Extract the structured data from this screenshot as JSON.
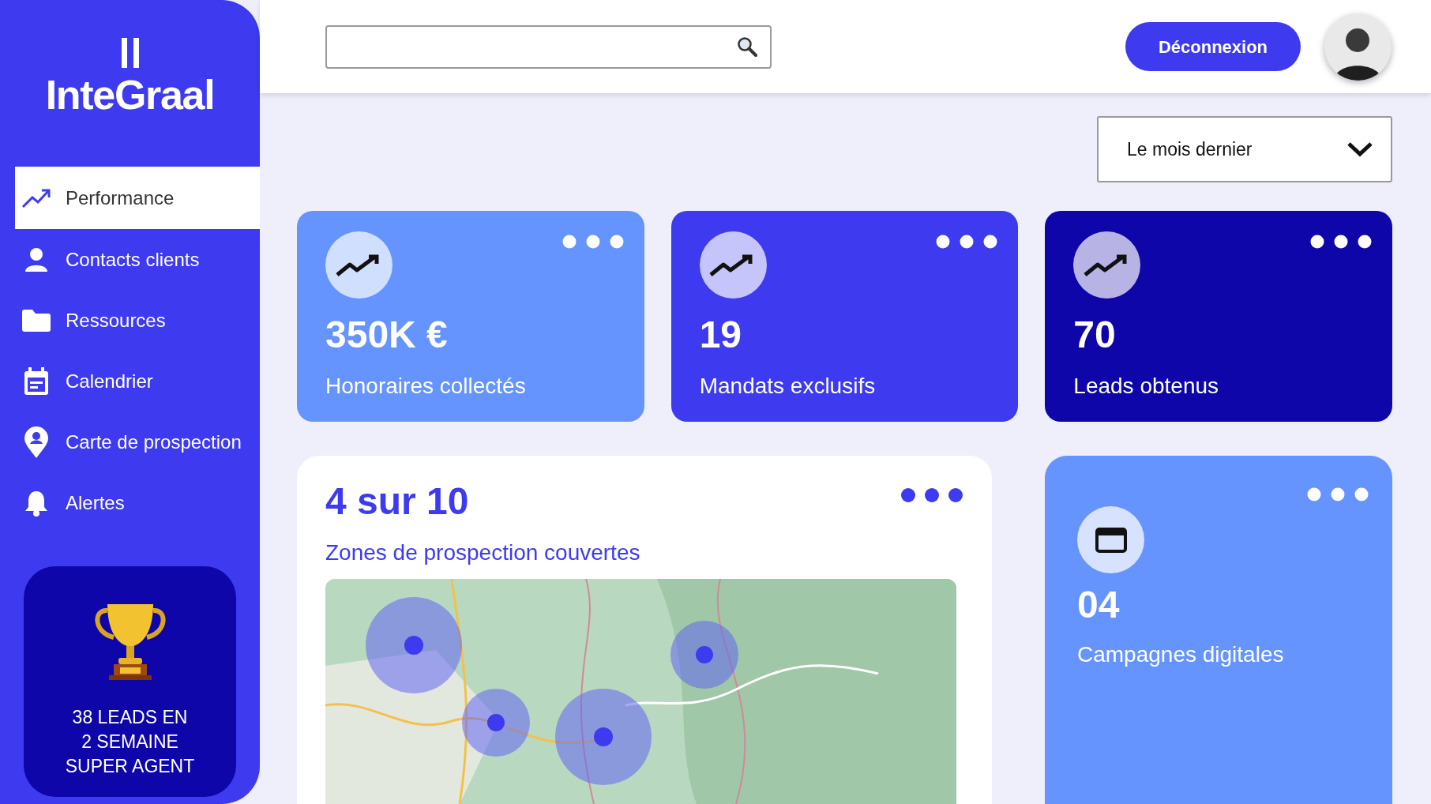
{
  "sidebar": {
    "logo": "InteGraal",
    "items": [
      {
        "kind": "trend",
        "label": "Performance",
        "selected": true
      },
      {
        "kind": "person",
        "label": "Contacts clients",
        "selected": false
      },
      {
        "kind": "folder",
        "label": "Ressources",
        "selected": false
      },
      {
        "kind": "calendar",
        "label": "Calendrier",
        "selected": false
      },
      {
        "kind": "pin",
        "label": "Carte de prospection",
        "selected": false
      },
      {
        "kind": "bell",
        "label": "Alertes",
        "selected": false
      }
    ],
    "award": {
      "lines": [
        "38 LEADS EN",
        "2 SEMAINE",
        "SUPER AGENT"
      ]
    }
  },
  "header": {
    "logout": "Déconnexion"
  },
  "period": {
    "value": "Le mois dernier"
  },
  "stats": [
    {
      "value": "350K €",
      "label": "Honoraires collectés",
      "color": "#6694fe"
    },
    {
      "value": "19",
      "label": "Mandats exclusifs",
      "color": "#3d3af0"
    },
    {
      "value": "70",
      "label": "Leads obtenus",
      "color": "#0e06a8"
    }
  ],
  "zones": {
    "value": "4 sur 10",
    "label": "Zones de prospection couvertes"
  },
  "campaigns": {
    "value": "04",
    "label": "Campagnes digitales"
  }
}
